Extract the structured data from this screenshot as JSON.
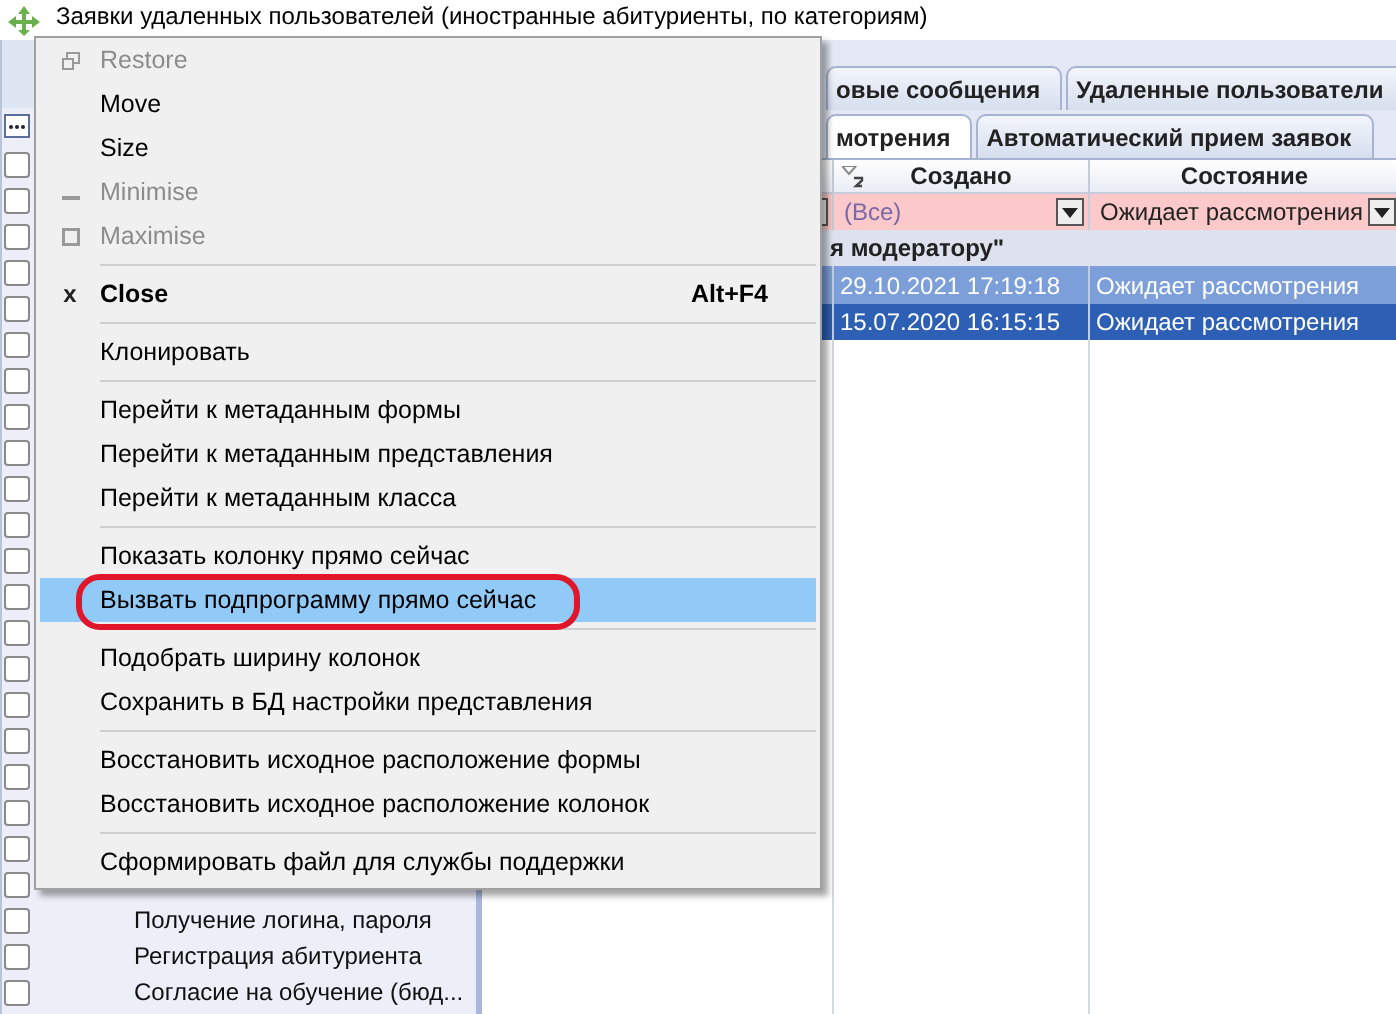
{
  "window": {
    "title": "Заявки удаленных пользователей (иностранные абитуриенты, по категориям)"
  },
  "left_panel": {
    "rows": [
      {
        "checked": false
      },
      {
        "checked": false
      },
      {
        "checked": false
      },
      {
        "checked": false
      },
      {
        "checked": false
      },
      {
        "checked": false
      },
      {
        "checked": false
      },
      {
        "checked": false
      },
      {
        "checked": false
      },
      {
        "checked": false
      },
      {
        "checked": false
      },
      {
        "checked": false
      },
      {
        "checked": false
      },
      {
        "checked": false
      },
      {
        "checked": false
      },
      {
        "checked": false
      },
      {
        "checked": false
      },
      {
        "checked": false
      },
      {
        "checked": false
      },
      {
        "checked": false
      },
      {
        "checked": false
      },
      {
        "checked": false,
        "label": "Получение логина, пароля"
      },
      {
        "checked": false,
        "label": "Регистрация абитуриента"
      },
      {
        "checked": false,
        "label": "Согласие на обучение (бюд..."
      }
    ]
  },
  "tabs_top": [
    {
      "label": "овые сообщения",
      "selected": false
    },
    {
      "label": "Удаленные пользователи",
      "selected": false
    }
  ],
  "tabs_bottom": [
    {
      "label": "мотрения",
      "selected": true
    },
    {
      "label": "Автоматический прием заявок",
      "selected": false
    }
  ],
  "grid": {
    "columns": [
      {
        "label": "Создано",
        "sorted": true
      },
      {
        "label": "Состояние",
        "sorted": false
      }
    ],
    "filters": [
      "(Все)",
      "Ожидает рассмотрения"
    ],
    "group": "я модератору\"",
    "rows": [
      {
        "cells": [
          "29.10.2021 17:19:18",
          "Ожидает рассмотрения"
        ],
        "selected": true,
        "current": false
      },
      {
        "cells": [
          "15.07.2020 16:15:15",
          "Ожидает рассмотрения"
        ],
        "selected": true,
        "current": true
      }
    ]
  },
  "context_menu": {
    "items": [
      {
        "kind": "restore",
        "label": "Restore",
        "disabled": true,
        "selected": false
      },
      {
        "kind": "item",
        "label": "Move",
        "disabled": false,
        "selected": false
      },
      {
        "kind": "item",
        "label": "Size",
        "disabled": false,
        "selected": false
      },
      {
        "kind": "minimise",
        "label": "Minimise",
        "disabled": true,
        "selected": false
      },
      {
        "kind": "maximise",
        "label": "Maximise",
        "disabled": true,
        "selected": false
      },
      {
        "kind": "separator"
      },
      {
        "kind": "item",
        "label": "Close",
        "glyph": "x",
        "shortcut": "Alt+F4",
        "default": true,
        "disabled": false,
        "selected": false
      },
      {
        "kind": "separator"
      },
      {
        "kind": "item",
        "label": "Клонировать",
        "disabled": false,
        "selected": false
      },
      {
        "kind": "separator"
      },
      {
        "kind": "item",
        "label": "Перейти к метаданным формы",
        "disabled": false,
        "selected": false
      },
      {
        "kind": "item",
        "label": "Перейти к метаданным представления",
        "disabled": false,
        "selected": false
      },
      {
        "kind": "item",
        "label": "Перейти к метаданным класса",
        "disabled": false,
        "selected": false
      },
      {
        "kind": "separator"
      },
      {
        "kind": "item",
        "label": "Показать колонку прямо сейчас",
        "disabled": false,
        "selected": false
      },
      {
        "kind": "item",
        "label": "Вызвать подпрограмму прямо сейчас",
        "disabled": false,
        "selected": true,
        "circled": true
      },
      {
        "kind": "separator"
      },
      {
        "kind": "item",
        "label": "Подобрать ширину колонок",
        "disabled": false,
        "selected": false
      },
      {
        "kind": "item",
        "label": "Сохранить в БД настройки представления",
        "disabled": false,
        "selected": false
      },
      {
        "kind": "separator"
      },
      {
        "kind": "item",
        "label": "Восстановить исходное расположение формы",
        "disabled": false,
        "selected": false
      },
      {
        "kind": "item",
        "label": "Восстановить исходное расположение колонок",
        "disabled": false,
        "selected": false
      },
      {
        "kind": "separator"
      },
      {
        "kind": "item",
        "label": "Сформировать файл для службы поддержки",
        "disabled": false,
        "selected": false
      }
    ]
  }
}
